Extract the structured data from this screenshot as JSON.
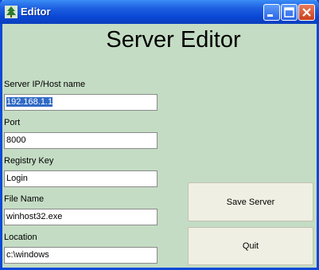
{
  "window": {
    "title": "Editor",
    "titlebar_color": "#0a48d6",
    "body_color": "#c4dcc4"
  },
  "heading": "Server Editor",
  "fields": [
    {
      "label": "Server IP/Host name",
      "value": "192.168.1.1",
      "selected": true
    },
    {
      "label": "Port",
      "value": "8000"
    },
    {
      "label": "Registry Key",
      "value": "Login"
    },
    {
      "label": "File Name",
      "value": "winhost32.exe"
    },
    {
      "label": "Location",
      "value": "c:\\windows"
    }
  ],
  "buttons": {
    "save": "Save Server",
    "quit": "Quit"
  },
  "icons": {
    "app": "tree-icon",
    "minimize": "minimize-icon",
    "maximize": "maximize-icon",
    "close": "close-icon"
  }
}
